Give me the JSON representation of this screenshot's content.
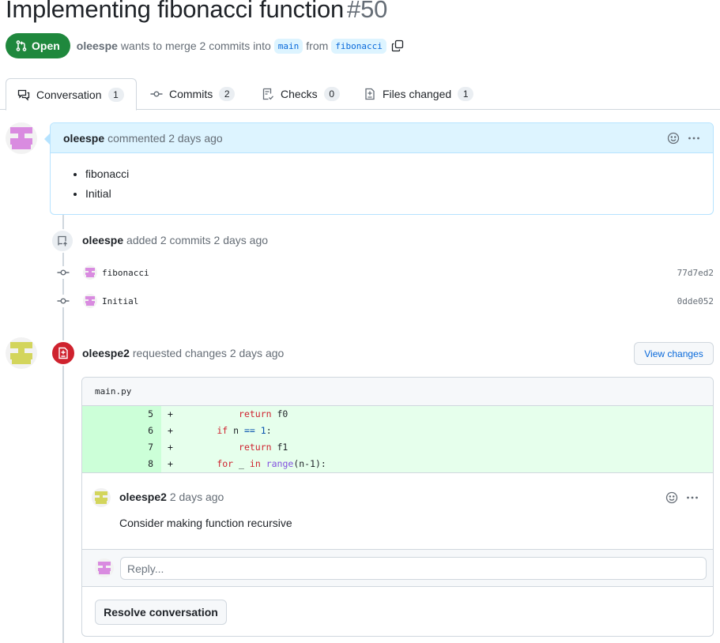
{
  "header": {
    "title": "Implementing fibonacci function",
    "number": "#50",
    "state": "Open",
    "author": "oleespe",
    "merge_text_1": "wants to merge 2 commits into",
    "base_branch": "main",
    "merge_text_2": "from",
    "head_branch": "fibonacci"
  },
  "tabs": [
    {
      "label": "Conversation",
      "count": "1",
      "icon": "conversation-icon",
      "active": true
    },
    {
      "label": "Commits",
      "count": "2",
      "icon": "commit-icon",
      "active": false
    },
    {
      "label": "Checks",
      "count": "0",
      "icon": "checklist-icon",
      "active": false
    },
    {
      "label": "Files changed",
      "count": "1",
      "icon": "file-diff-icon",
      "active": false
    }
  ],
  "first_comment": {
    "author": "oleespe",
    "action": "commented",
    "time": "2 days ago",
    "items": [
      "fibonacci",
      "Initial"
    ]
  },
  "commits_event": {
    "author": "oleespe",
    "text": "added 2 commits",
    "time": "2 days ago",
    "commits": [
      {
        "message": "fibonacci",
        "sha": "77d7ed2"
      },
      {
        "message": "Initial",
        "sha": "0dde052"
      }
    ]
  },
  "review": {
    "author": "oleespe2",
    "text": "requested changes",
    "time": "2 days ago",
    "view_changes_label": "View changes",
    "file": "main.py",
    "diff_lines": [
      {
        "num": "5",
        "sign": "+",
        "code": "        return f0"
      },
      {
        "num": "6",
        "sign": "+",
        "code": "    if n == 1:"
      },
      {
        "num": "7",
        "sign": "+",
        "code": "        return f1"
      },
      {
        "num": "8",
        "sign": "+",
        "code": "    for _ in range(n-1):"
      }
    ],
    "inline_comment": {
      "author": "oleespe2",
      "time": "2 days ago",
      "body": "Consider making function recursive"
    },
    "reply_placeholder": "Reply...",
    "resolve_label": "Resolve conversation"
  },
  "colors": {
    "open_green": "#1f883d",
    "link_blue": "#0969da",
    "request_changes_red": "#cf222e",
    "avatar_purple": "#d98be0",
    "avatar_yellow": "#d3d55c"
  }
}
